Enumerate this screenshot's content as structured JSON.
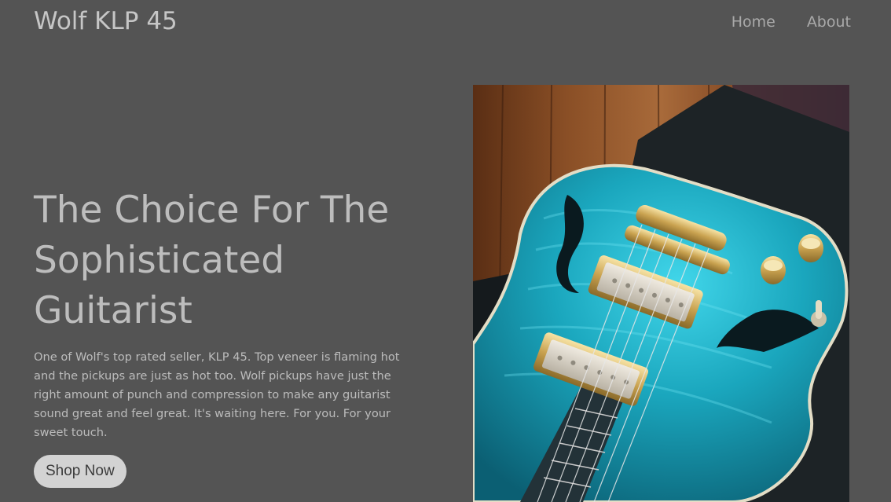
{
  "header": {
    "brand": "Wolf KLP 45",
    "nav": [
      {
        "label": "Home"
      },
      {
        "label": "About"
      }
    ]
  },
  "hero": {
    "headline_lines": [
      "The Choice For The",
      "Sophisticated",
      "Guitarist"
    ],
    "description": "One of Wolf's top rated seller, KLP 45. Top veneer is flaming hot and the pickups are just as hot too. Wolf pickups have just the right amount of punch and compression to make any guitarist sound great and feel great. It's waiting here. For you. For your sweet touch.",
    "cta_label": "Shop Now"
  },
  "image": {
    "subject": "teal-flame-top-semi-hollow-electric-guitar"
  },
  "colors": {
    "background": "#545454",
    "brand_text": "#c6c6c6",
    "nav_text": "#a9a9a9",
    "headline_text": "#bdbdbd",
    "button_bg": "#d3d3d3",
    "guitar_teal": "#1fa3b8"
  }
}
